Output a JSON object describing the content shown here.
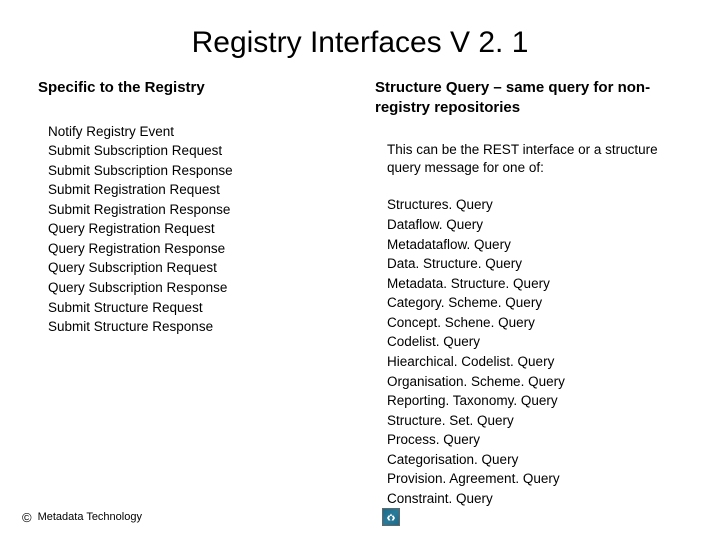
{
  "title": "Registry Interfaces V 2. 1",
  "left": {
    "heading": "Specific to the Registry",
    "items": [
      "Notify Registry Event",
      "Submit Subscription Request",
      "Submit Subscription Response",
      "Submit Registration Request",
      "Submit Registration Response",
      "Query Registration Request",
      "Query Registration Response",
      "Query Subscription Request",
      "Query Subscription Response",
      "Submit Structure Request",
      "Submit Structure Response"
    ]
  },
  "right": {
    "heading": "Structure Query – same query for non-registry repositories",
    "intro": "This can be the REST interface or a structure query message for one of:",
    "items": [
      "Structures. Query",
      "Dataflow. Query",
      "Metadataflow. Query",
      "Data. Structure. Query",
      "Metadata. Structure. Query",
      "Category. Scheme. Query",
      "Concept. Schene. Query",
      "Codelist. Query",
      "Hiearchical. Codelist. Query",
      "Organisation. Scheme. Query",
      "Reporting. Taxonomy. Query",
      "Structure. Set. Query",
      "Process. Query",
      "Categorisation. Query",
      "Provision. Agreement. Query",
      "Constraint. Query"
    ]
  },
  "footer": {
    "copyright": "©",
    "text": "Metadata Technology"
  }
}
